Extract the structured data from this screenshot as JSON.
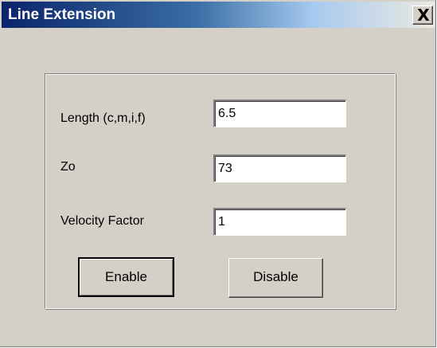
{
  "window": {
    "title": "Line Extension",
    "close_glyph": "X"
  },
  "fields": [
    {
      "label": "Length (c,m,i,f)",
      "value": "6.5"
    },
    {
      "label": "Zo",
      "value": "73"
    },
    {
      "label": "Velocity Factor",
      "value": "1"
    }
  ],
  "buttons": {
    "enable_label": "Enable",
    "disable_label": "Disable"
  },
  "icons": {
    "close": "close-icon"
  },
  "colors": {
    "dialog_face": "#d4d0c8",
    "titlebar_start": "#0a246a",
    "titlebar_end": "#a6caf0",
    "title_text": "#ffffff"
  }
}
